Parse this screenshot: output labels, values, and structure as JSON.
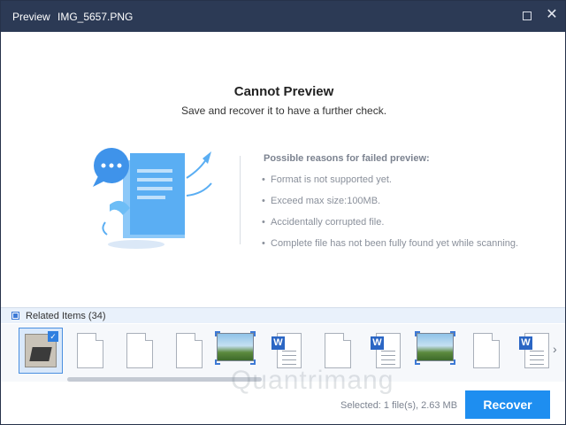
{
  "titlebar": {
    "title": "Preview",
    "filename": "IMG_5657.PNG",
    "close_glyph": "✕"
  },
  "preview": {
    "heading": "Cannot Preview",
    "subheading": "Save and recover it to have a further check.",
    "reasons_title": "Possible reasons for failed preview:",
    "reasons": [
      "Format is not supported yet.",
      "Exceed max size:100MB.",
      "Accidentally corrupted file.",
      "Complete file has not been fully found yet while scanning."
    ]
  },
  "related": {
    "label": "Related Items (34)"
  },
  "thumbnails": [
    {
      "type": "photo",
      "selected": true
    },
    {
      "type": "blank"
    },
    {
      "type": "blank"
    },
    {
      "type": "blank"
    },
    {
      "type": "image",
      "highlighted": true
    },
    {
      "type": "word"
    },
    {
      "type": "blank"
    },
    {
      "type": "word"
    },
    {
      "type": "image",
      "highlighted": true
    },
    {
      "type": "blank"
    },
    {
      "type": "word"
    }
  ],
  "footer": {
    "watermark": "Quantrimang",
    "selected_info": "Selected: 1 file(s), 2.63 MB",
    "recover_label": "Recover"
  },
  "colors": {
    "titlebar": "#2c3a55",
    "accent": "#1e8ef0",
    "illustration": "#4fa3ee"
  }
}
